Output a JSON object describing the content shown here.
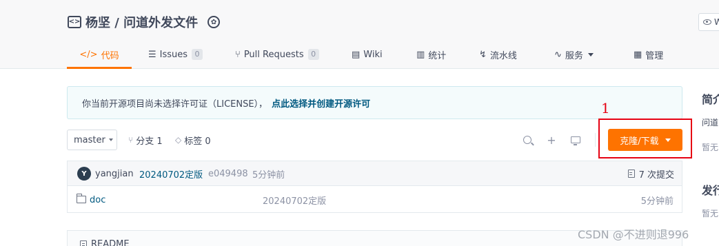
{
  "header": {
    "repo_title": "杨坚 / 问道外发文件",
    "watch_label": "W"
  },
  "tabs": [
    {
      "icon": "</>",
      "label": "代码",
      "active": true
    },
    {
      "icon": "☰",
      "label": "Issues",
      "badge": "0"
    },
    {
      "icon": "⑂",
      "label": "Pull Requests",
      "badge": "0"
    },
    {
      "icon": "▤",
      "label": "Wiki"
    },
    {
      "icon": "▥",
      "label": "统计"
    },
    {
      "icon": "↯",
      "label": "流水线"
    },
    {
      "icon": "∿",
      "label": "服务"
    },
    {
      "icon": "▦",
      "label": "管理"
    }
  ],
  "notice": {
    "text": "你当前开源项目尚未选择许可证（LICENSE），",
    "link": "点此选择并创建开源许可"
  },
  "toolbar": {
    "branch": "master",
    "branches_label": "分支 1",
    "tags_label": "标签 0",
    "clone_label": "克隆/下载"
  },
  "annotation": {
    "number": "1"
  },
  "commit": {
    "avatar_letter": "Y",
    "author": "yangjian",
    "message": "20240702定版",
    "hash": "e049498",
    "time": "5分钟前",
    "count_label": "7 次提交"
  },
  "files": [
    {
      "name": "doc",
      "commit": "20240702定版",
      "time": "5分钟前"
    }
  ],
  "readme": {
    "label": "README"
  },
  "sidebar": {
    "intro_heading": "简介",
    "intro_text": "问道",
    "intro_empty": "暂无",
    "release_heading": "发行",
    "release_empty": "暂无"
  },
  "watermark": "CSDN @不进则退996",
  "colors": {
    "accent": "#fe7300",
    "link": "#005980",
    "annotation_red": "#e60012"
  }
}
